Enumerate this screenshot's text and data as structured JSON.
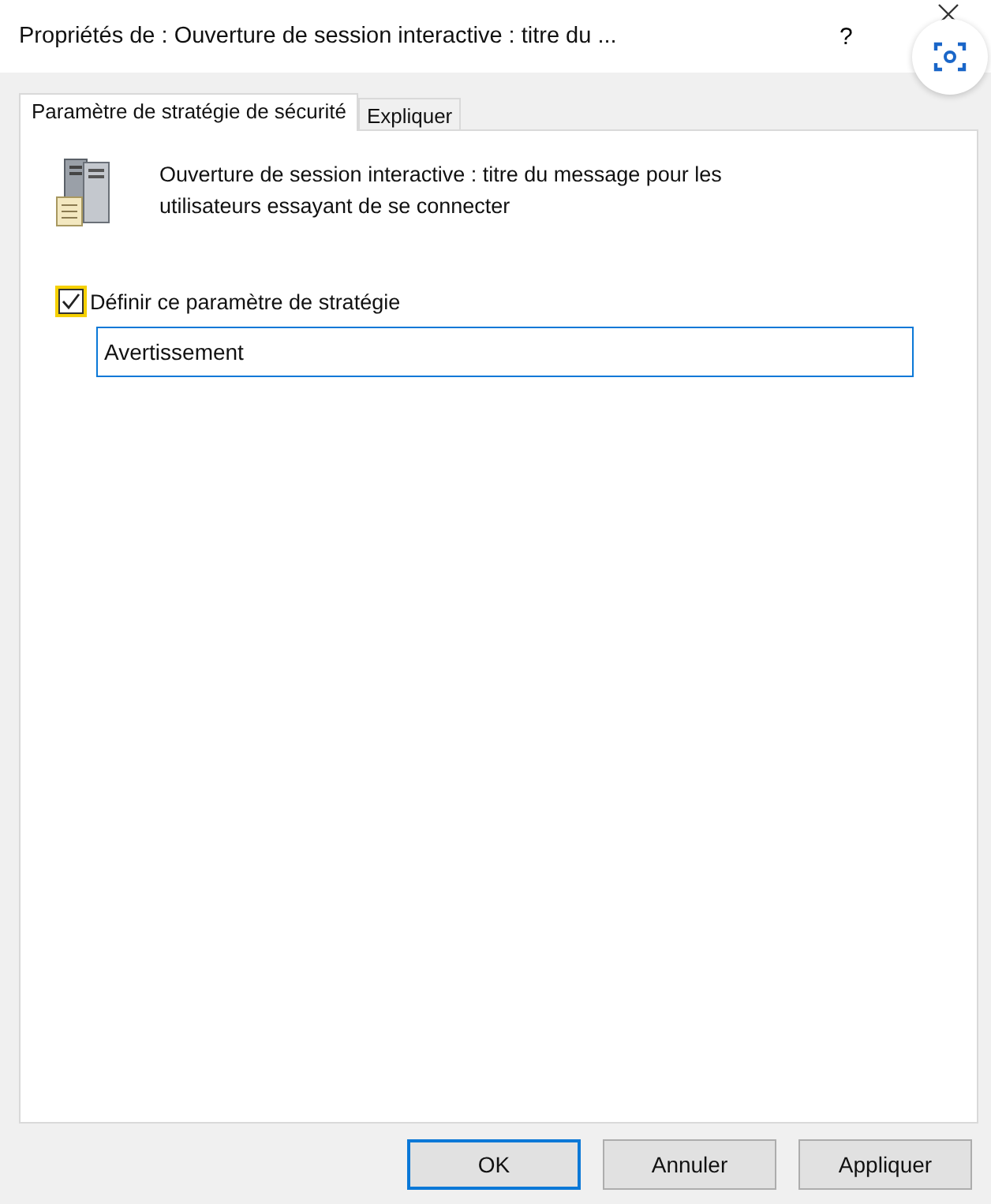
{
  "window": {
    "title": "Propriétés de : Ouverture de session interactive : titre du ...",
    "help": "?"
  },
  "tabs": [
    {
      "label": "Paramètre de stratégie de sécurité",
      "selected": true
    },
    {
      "label": "Expliquer",
      "selected": false
    }
  ],
  "policy": {
    "description": "Ouverture de session interactive : titre du message pour les utilisateurs essayant de se connecter"
  },
  "define_setting": {
    "label": "Définir ce paramètre de stratégie",
    "checked": true,
    "value": "Avertissement"
  },
  "buttons": [
    {
      "label": "OK",
      "default": true
    },
    {
      "label": "Annuler",
      "default": false
    },
    {
      "label": "Appliquer",
      "default": false
    }
  ]
}
